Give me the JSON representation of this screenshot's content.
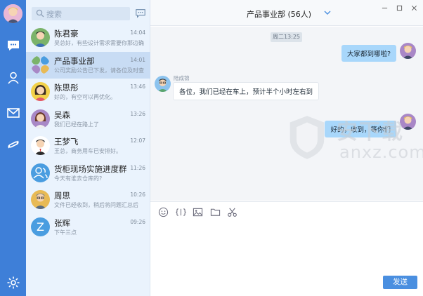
{
  "sidebar": {
    "search_placeholder": "搜索"
  },
  "conversations": [
    {
      "name": "陈君豪",
      "time": "14:04",
      "preview": "吴总好，有些设计需求需要你那边确",
      "avatar": "man-dark-hair",
      "color": "#7bb36a"
    },
    {
      "name": "产品事业部",
      "time": "14:01",
      "preview": "公司奖励公告已下发，请各位及时查",
      "avatar": "group",
      "color": "#4a9de0",
      "active": true
    },
    {
      "name": "陈思彤",
      "time": "13:46",
      "preview": "好的，有空可以再优化。",
      "avatar": "woman",
      "color": "#f2d14a"
    },
    {
      "name": "吴森",
      "time": "13:26",
      "preview": "我们已经在路上了",
      "avatar": "woman-purple",
      "color": "#a888c6"
    },
    {
      "name": "王梦飞",
      "time": "12:07",
      "preview": "王总，商务用车已安排好。",
      "avatar": "man-black",
      "color": "#ffffff"
    },
    {
      "name": "货柜现场实施进度群",
      "time": "11:26",
      "preview": "今天有谁去仓库的?",
      "avatar": "group-icon",
      "color": "#4a9de0"
    },
    {
      "name": "周思",
      "time": "10:26",
      "preview": "文件已经收到，稍后将问题汇总后",
      "avatar": "man-glasses",
      "color": "#e8ba55"
    },
    {
      "name": "张辉",
      "time": "09:26",
      "preview": "下午三点",
      "avatar": "letter-z",
      "letter": "Z",
      "color": "#4a9de0"
    }
  ],
  "chat": {
    "title": "产品事业部 (56人)",
    "timestamp": "周二13:25",
    "messages": [
      {
        "from": "me",
        "text": "大家都到哪啦?"
      },
      {
        "from": "other",
        "sender": "陆成锦",
        "text": "各位，我们已经在车上，预计半个小时左右到"
      },
      {
        "from": "me",
        "text": "好的，收到，等你们"
      }
    ],
    "send_label": "发送",
    "toolbar": [
      "emoji-icon",
      "code-icon",
      "image-icon",
      "folder-icon",
      "scissors-icon"
    ]
  },
  "window_controls": [
    "minimize",
    "maximize",
    "close"
  ],
  "watermark": {
    "cn": "安下载",
    "en": "anxz.com"
  },
  "colors": {
    "rail": "#3e7fd8",
    "active_row": "#c8dcf4",
    "list_bg": "#eaf3fd",
    "my_bubble": "#a8d7fb",
    "send": "#4a8fe0"
  }
}
